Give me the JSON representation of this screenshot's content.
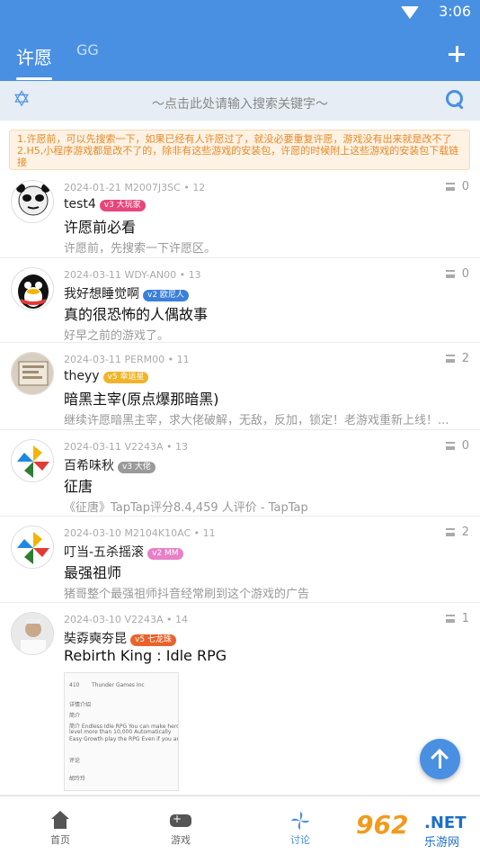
{
  "status": {
    "time": "3:06"
  },
  "tabs": [
    {
      "label": "许愿",
      "active": true
    },
    {
      "label": "GG",
      "active": false
    }
  ],
  "search": {
    "placeholder": "～点击此处请输入搜索关键字～"
  },
  "notice": "1.许愿前，可以先搜索一下，如果已经有人许愿过了，就没必要重复许愿，游戏没有出来就是改不了 2.H5,小程序游戏都是改不了的，除非有这些游戏的安装包，许愿的时候附上这些游戏的安装包下载链接",
  "posts": [
    {
      "date": "2024-01-21",
      "device": "M2007J3SC",
      "floor": "12",
      "comments": "0",
      "user": "test4",
      "badge": "v3 大玩家",
      "badge_color": "#e8457a",
      "title": "许愿前必看",
      "excerpt": "许愿前，先搜索一下许愿区。",
      "avatar": "panda-meme-avatar"
    },
    {
      "date": "2024-03-11",
      "device": "WDY-AN00",
      "floor": "13",
      "comments": "0",
      "user": "我好想睡觉啊",
      "badge": "v2 欧尼人",
      "badge_color": "#3a7fd9",
      "title": "真的很恐怖的人偶故事",
      "excerpt": "好早之前的游戏了。",
      "avatar": "penguin-avatar"
    },
    {
      "date": "2024-03-11",
      "device": "PERM00",
      "floor": "11",
      "comments": "2",
      "user": "theyy",
      "badge": "v5 幸运星",
      "badge_color": "#f0b428",
      "title": "暗黑主宰(原点爆那暗黑)",
      "excerpt": "继续许愿暗黑主宰，求大佬破解，无敌，反加，锁定！老游戏重新上线！...",
      "avatar": "image-avatar"
    },
    {
      "date": "2024-03-11",
      "device": "V2243A",
      "floor": "13",
      "comments": "0",
      "user": "百希味秋",
      "badge": "v3 大佬",
      "badge_color": "#9a9a9a",
      "title": "征唐",
      "excerpt": "《征唐》TapTap评分8.4,459 人评价 - TapTap",
      "avatar": "pinwheel-avatar"
    },
    {
      "date": "2024-03-10",
      "device": "M2104K10AC",
      "floor": "11",
      "comments": "2",
      "user": "叮当-五杀摇滚",
      "badge": "v2 MM",
      "badge_color": "#e87fc7",
      "title": "最强祖师",
      "excerpt": "猪哥整个最强祖师抖音经常刷到这个游戏的广告",
      "avatar": "pinwheel-avatar"
    },
    {
      "date": "2024-03-10",
      "device": "V2243A",
      "floor": "14",
      "comments": "1",
      "user": "奘孬奭夯昆",
      "badge": "v5 七龙珠",
      "badge_color": "#e8632a",
      "title": "Rebirth King : Idle RPG",
      "excerpt": "",
      "avatar": "man-photo-avatar"
    }
  ],
  "thumbnail": {
    "line1": "Thunder Games Inc",
    "line2": "410",
    "line3": "详情介绍",
    "line4": "简介",
    "line5": "简介 Endless Idle RPG You can make hero",
    "line6": "level more than 10,000 Automatically",
    "line7": "Easy Growth play the RPG Even if you are",
    "line8": "评论",
    "line9": "胡玲玲"
  },
  "nav": [
    {
      "label": "首页",
      "icon": "home-icon",
      "active": false
    },
    {
      "label": "游戏",
      "icon": "gamepad-icon",
      "active": false
    },
    {
      "label": "讨论",
      "icon": "pinwheel-icon",
      "active": true
    }
  ],
  "watermark": {
    "num": "962",
    "net": ".NET",
    "site": "乐游网"
  },
  "colors": {
    "primary": "#4a90e2",
    "notice_text": "#e6892a"
  }
}
